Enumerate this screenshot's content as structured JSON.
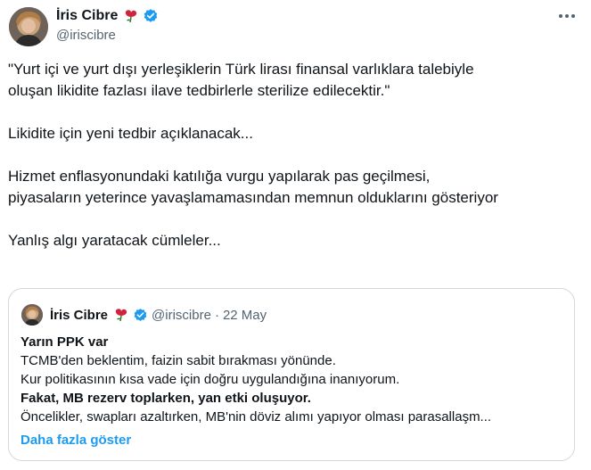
{
  "author": {
    "display_name": "İris Cibre",
    "handle": "@iriscibre"
  },
  "tweet": {
    "paragraphs": [
      "\"Yurt içi ve yurt dışı yerleşiklerin Türk lirası finansal varlıklara talebiyle\noluşan likidite fazlası ilave tedbirlerle sterilize edilecektir.\"",
      "Likidite için yeni tedbir açıklanacak...",
      "Hizmet enflasyonundaki katılığa vurgu yapılarak pas geçilmesi,\npiyasaların yeterince yavaşlamamasından memnun olduklarını gösteriyor",
      "Yanlış algı yaratacak cümleler..."
    ]
  },
  "quoted_tweet": {
    "display_name": "İris Cibre",
    "handle": "@iriscibre",
    "separator": "·",
    "date": "22 May",
    "lines": [
      "Yarın PPK var",
      "TCMB'den beklentim, faizin sabit bırakması yönünde.",
      "Kur politikasının kısa vade için doğru uygulandığına inanıyorum.",
      "Fakat, MB rezerv toplarken, yan etki oluşuyor.",
      "Öncelikler, swapları azaltırken, MB'nin döviz alımı yapıyor olması parasallaşm..."
    ],
    "show_more": "Daha fazla göster"
  },
  "colors": {
    "link": "#1d9bf0",
    "verified": "#1d9bf0",
    "rose": "#d0243c",
    "muted": "#536471",
    "border": "#cfd9de"
  },
  "icons": [
    "avatar",
    "rose-icon",
    "verified-badge-icon",
    "more-options-icon"
  ]
}
